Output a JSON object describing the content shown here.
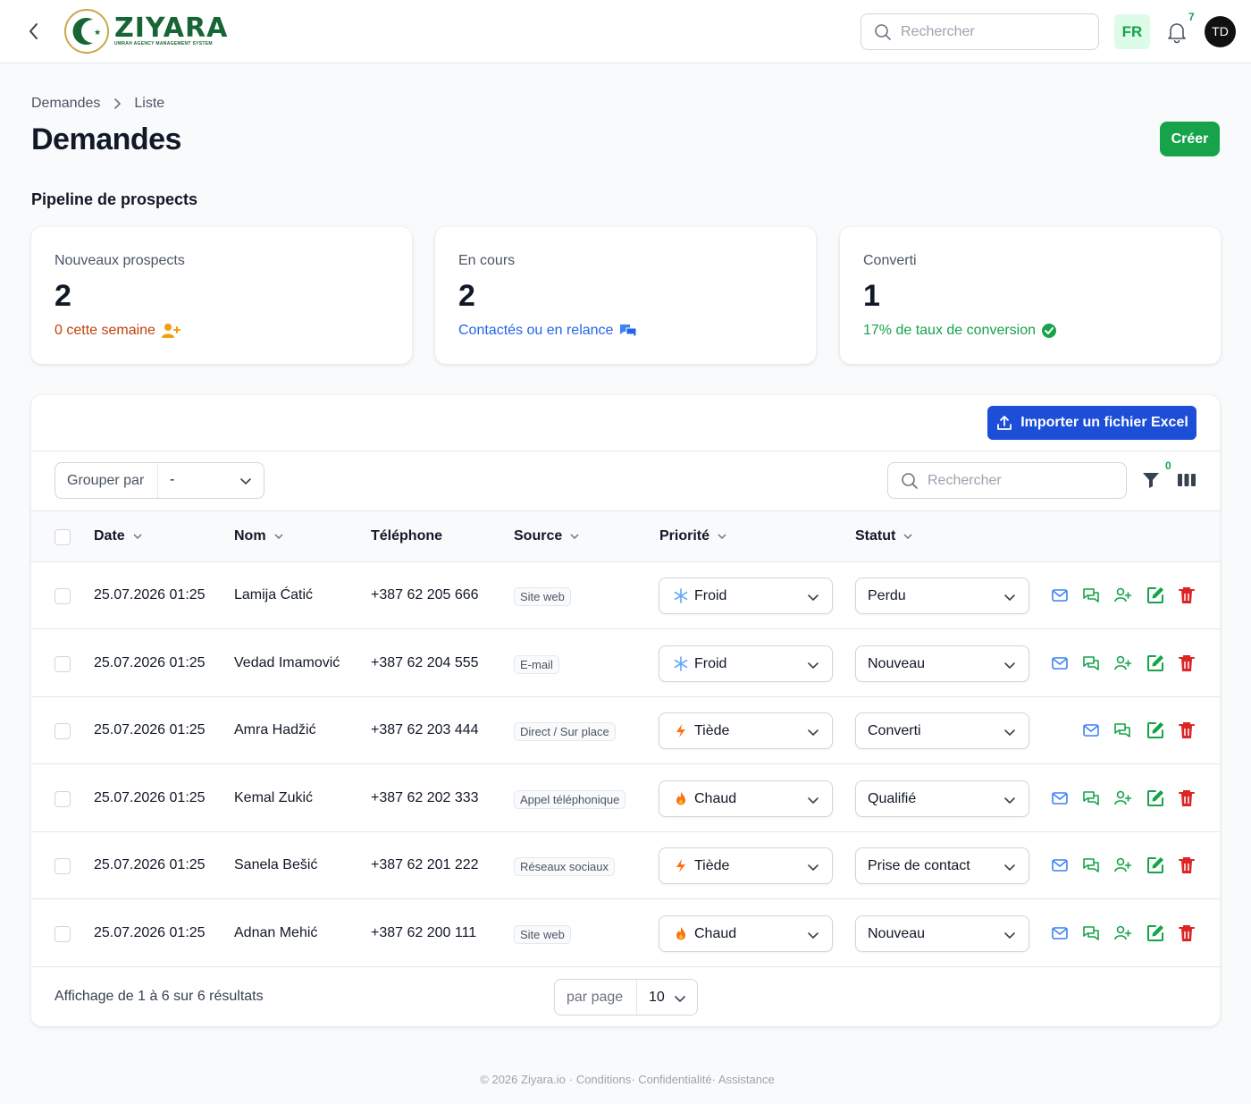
{
  "app": {
    "brand": "ZIYARA",
    "brand_tagline": "UMRAH AGENCY MANAGEMENT SYSTEM",
    "search_placeholder": "Rechercher",
    "language": "FR",
    "notifications_count": "7",
    "user_initials": "TD"
  },
  "breadcrumb": {
    "parent": "Demandes",
    "current": "Liste"
  },
  "page": {
    "title": "Demandes",
    "create_label": "Créer",
    "section_title": "Pipeline de prospects"
  },
  "stats": [
    {
      "label": "Nouveaux prospects",
      "value": "2",
      "desc": "0 cette semaine",
      "color": "#c2410c",
      "icon": "user-plus-icon"
    },
    {
      "label": "En cours",
      "value": "2",
      "desc": "Contactés ou en relance",
      "color": "#2563eb",
      "icon": "chat-bubbles-icon"
    },
    {
      "label": "Converti",
      "value": "1",
      "desc": "17% de taux de conversion",
      "color": "#16a34a",
      "icon": "check-badge-icon"
    }
  ],
  "toolbar": {
    "import_label": "Importer un fichier Excel",
    "group_by_label": "Grouper par",
    "group_by_value": "-",
    "search_placeholder": "Rechercher",
    "filter_count": "0"
  },
  "table": {
    "columns": {
      "date": "Date",
      "name": "Nom",
      "phone": "Téléphone",
      "source": "Source",
      "priority": "Priorité",
      "status": "Statut"
    },
    "rows": [
      {
        "date": "25.07.2026 01:25",
        "name": "Lamija Ćatić",
        "phone": "+387 62 205 666",
        "source": "Site web",
        "priority": "Froid",
        "priority_icon": "snowflake-icon",
        "status": "Perdu",
        "convert_action": true
      },
      {
        "date": "25.07.2026 01:25",
        "name": "Vedad Imamović",
        "phone": "+387 62 204 555",
        "source": "E-mail",
        "priority": "Froid",
        "priority_icon": "snowflake-icon",
        "status": "Nouveau",
        "convert_action": true
      },
      {
        "date": "25.07.2026 01:25",
        "name": "Amra Hadžić",
        "phone": "+387 62 203 444",
        "source": "Direct / Sur place",
        "priority": "Tiède",
        "priority_icon": "bolt-icon",
        "status": "Converti",
        "convert_action": false
      },
      {
        "date": "25.07.2026 01:25",
        "name": "Kemal Zukić",
        "phone": "+387 62 202 333",
        "source": "Appel téléphonique",
        "priority": "Chaud",
        "priority_icon": "flame-icon",
        "status": "Qualifié",
        "convert_action": true
      },
      {
        "date": "25.07.2026 01:25",
        "name": "Sanela Bešić",
        "phone": "+387 62 201 222",
        "source": "Réseaux sociaux",
        "priority": "Tiède",
        "priority_icon": "bolt-icon",
        "status": "Prise de contact",
        "convert_action": true
      },
      {
        "date": "25.07.2026 01:25",
        "name": "Adnan Mehić",
        "phone": "+387 62 200 111",
        "source": "Site web",
        "priority": "Chaud",
        "priority_icon": "flame-icon",
        "status": "Nouveau",
        "convert_action": true
      }
    ]
  },
  "pagination": {
    "summary": "Affichage de 1 à 6 sur 6 résultats",
    "per_page_label": "par page",
    "per_page_value": "10"
  },
  "footer": {
    "copyright": "© 2026 Ziyara.io",
    "links": [
      "Conditions",
      "Confidentialité",
      "Assistance"
    ]
  },
  "colors": {
    "brand_green": "#16a34a",
    "import_blue": "#1d4ed8",
    "delete_red": "#dc2626",
    "action_blue": "#3b82f6"
  }
}
